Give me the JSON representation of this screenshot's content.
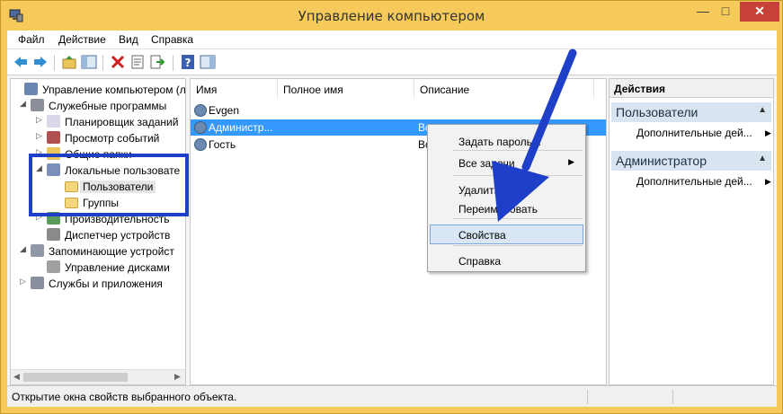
{
  "window": {
    "title": "Управление компьютером",
    "minimize_symbol": "—",
    "maximize_symbol": "□",
    "close_symbol": "✕"
  },
  "menu": [
    "Файл",
    "Действие",
    "Вид",
    "Справка"
  ],
  "toolbar": {
    "back": "back-arrow-icon",
    "forward": "forward-arrow-icon",
    "up": "up-folder-icon",
    "show_hide": "console-tree-icon",
    "delete": "delete-icon",
    "properties": "properties-icon",
    "export": "export-list-icon",
    "help": "help-icon",
    "show_action_pane": "action-pane-icon"
  },
  "tree": [
    {
      "label": "Управление компьютером (л",
      "level": 0,
      "arrow": "",
      "icon": "computer-management-icon"
    },
    {
      "label": "Служебные программы",
      "level": 1,
      "arrow": "◢",
      "icon": "tools-icon"
    },
    {
      "label": "Планировщик заданий",
      "level": 2,
      "arrow": "▷",
      "icon": "clock-icon"
    },
    {
      "label": "Просмотр событий",
      "level": 2,
      "arrow": "▷",
      "icon": "event-viewer-icon"
    },
    {
      "label": "Общие папки",
      "level": 2,
      "arrow": "▷",
      "icon": "shared-folder-icon"
    },
    {
      "label": "Локальные пользовате",
      "level": 2,
      "arrow": "◢",
      "icon": "local-users-icon"
    },
    {
      "label": "Пользователи",
      "level": 3,
      "arrow": "",
      "icon": "folder-icon",
      "selected": true
    },
    {
      "label": "Группы",
      "level": 3,
      "arrow": "",
      "icon": "folder-icon"
    },
    {
      "label": "Производительность",
      "level": 2,
      "arrow": "▷",
      "icon": "performance-icon"
    },
    {
      "label": "Диспетчер устройств",
      "level": 2,
      "arrow": "",
      "icon": "device-manager-icon"
    },
    {
      "label": "Запоминающие устройст",
      "level": 1,
      "arrow": "◢",
      "icon": "storage-icon"
    },
    {
      "label": "Управление дисками",
      "level": 2,
      "arrow": "",
      "icon": "disk-icon"
    },
    {
      "label": "Службы и приложения",
      "level": 1,
      "arrow": "▷",
      "icon": "services-icon"
    }
  ],
  "list": {
    "columns": [
      "Имя",
      "Полное имя",
      "Описание"
    ],
    "rows": [
      {
        "name": "Evgen",
        "full_name": "",
        "description": "",
        "selected": false
      },
      {
        "name": "Администр...",
        "full_name": "",
        "description": "Вс",
        "selected": true
      },
      {
        "name": "Гость",
        "full_name": "",
        "description": "Вс",
        "selected": false
      }
    ]
  },
  "context_menu": {
    "items": [
      {
        "label": "Задать пароль...",
        "submenu": false
      },
      {
        "label": "Все задачи",
        "submenu": true
      },
      {
        "label": "Удалить",
        "submenu": false
      },
      {
        "label": "Переименовать",
        "submenu": false
      },
      {
        "label": "Свойства",
        "submenu": false,
        "highlighted": true
      },
      {
        "label": "Справка",
        "submenu": false
      }
    ]
  },
  "actions": {
    "title": "Действия",
    "sections": [
      {
        "title": "Пользователи",
        "items": [
          "Дополнительные дей..."
        ]
      },
      {
        "title": "Администратор",
        "items": [
          "Дополнительные дей..."
        ]
      }
    ]
  },
  "status": {
    "text": "Открытие окна свойств выбранного объекта."
  },
  "colors": {
    "accent": "#3399ff",
    "annotation": "#1e3fc8",
    "frame": "#f5ca5a"
  }
}
